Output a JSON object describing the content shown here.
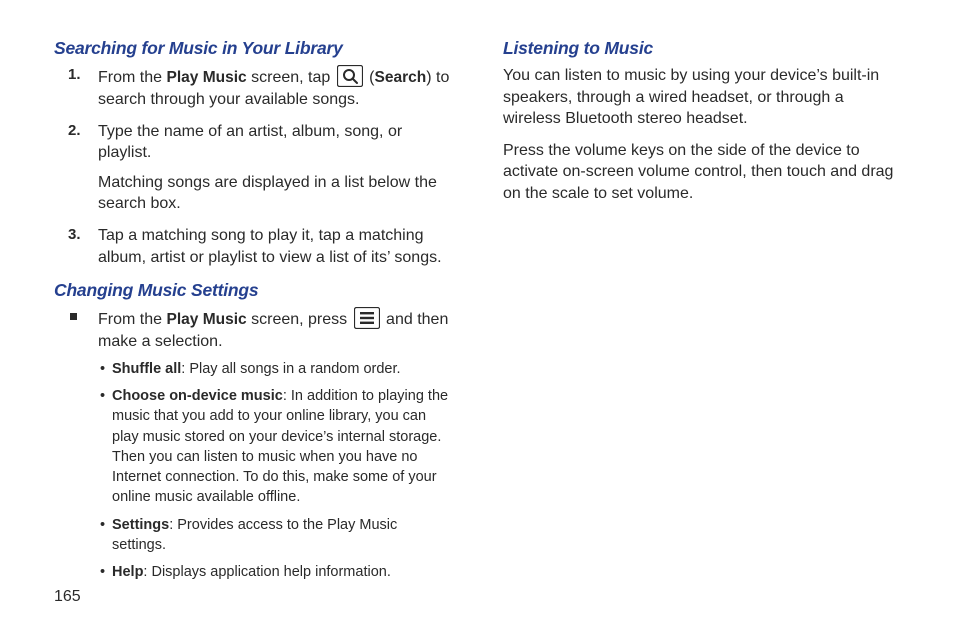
{
  "pageNumber": "165",
  "left": {
    "section1": {
      "title": "Searching for Music in Your Library",
      "steps": [
        {
          "num": "1.",
          "pre": "From the ",
          "b1": "Play Music",
          "mid1": " screen, tap ",
          "iconName": "search-icon",
          "mid2": " (",
          "b2": "Search",
          "post": ") to search through your available songs."
        },
        {
          "num": "2.",
          "line1": "Type the name of an artist, album, song, or playlist.",
          "line2": "Matching songs are displayed in a list below the search box."
        },
        {
          "num": "3.",
          "text": "Tap a matching song to play it, tap a matching album, artist or playlist to view a list of its’ songs."
        }
      ]
    },
    "section2": {
      "title": "Changing Music Settings",
      "lead": {
        "pre": "From the ",
        "b1": "Play Music",
        "mid1": " screen, press ",
        "iconName": "menu-icon",
        "post": " and then make a selection."
      },
      "bullets": [
        {
          "bold": "Shuffle all",
          "rest": ": Play all songs in a random order."
        },
        {
          "bold": "Choose on-device music",
          "rest": ": In addition to playing the music that you add to your online library, you can play music stored on your device’s internal storage. Then you can listen to music when you have no Internet connection. To do this, make some of your online music available offline."
        },
        {
          "bold": "Settings",
          "rest": ": Provides access to the Play Music settings."
        },
        {
          "bold": "Help",
          "rest": ": Displays application help information."
        }
      ]
    }
  },
  "right": {
    "section": {
      "title": "Listening to Music",
      "para1": "You can listen to music by using your device’s built-in speakers, through a wired headset, or through a wireless Bluetooth stereo headset.",
      "para2": "Press the volume keys on the side of the device to activate on-screen volume control, then touch and drag on the scale to set volume."
    }
  }
}
